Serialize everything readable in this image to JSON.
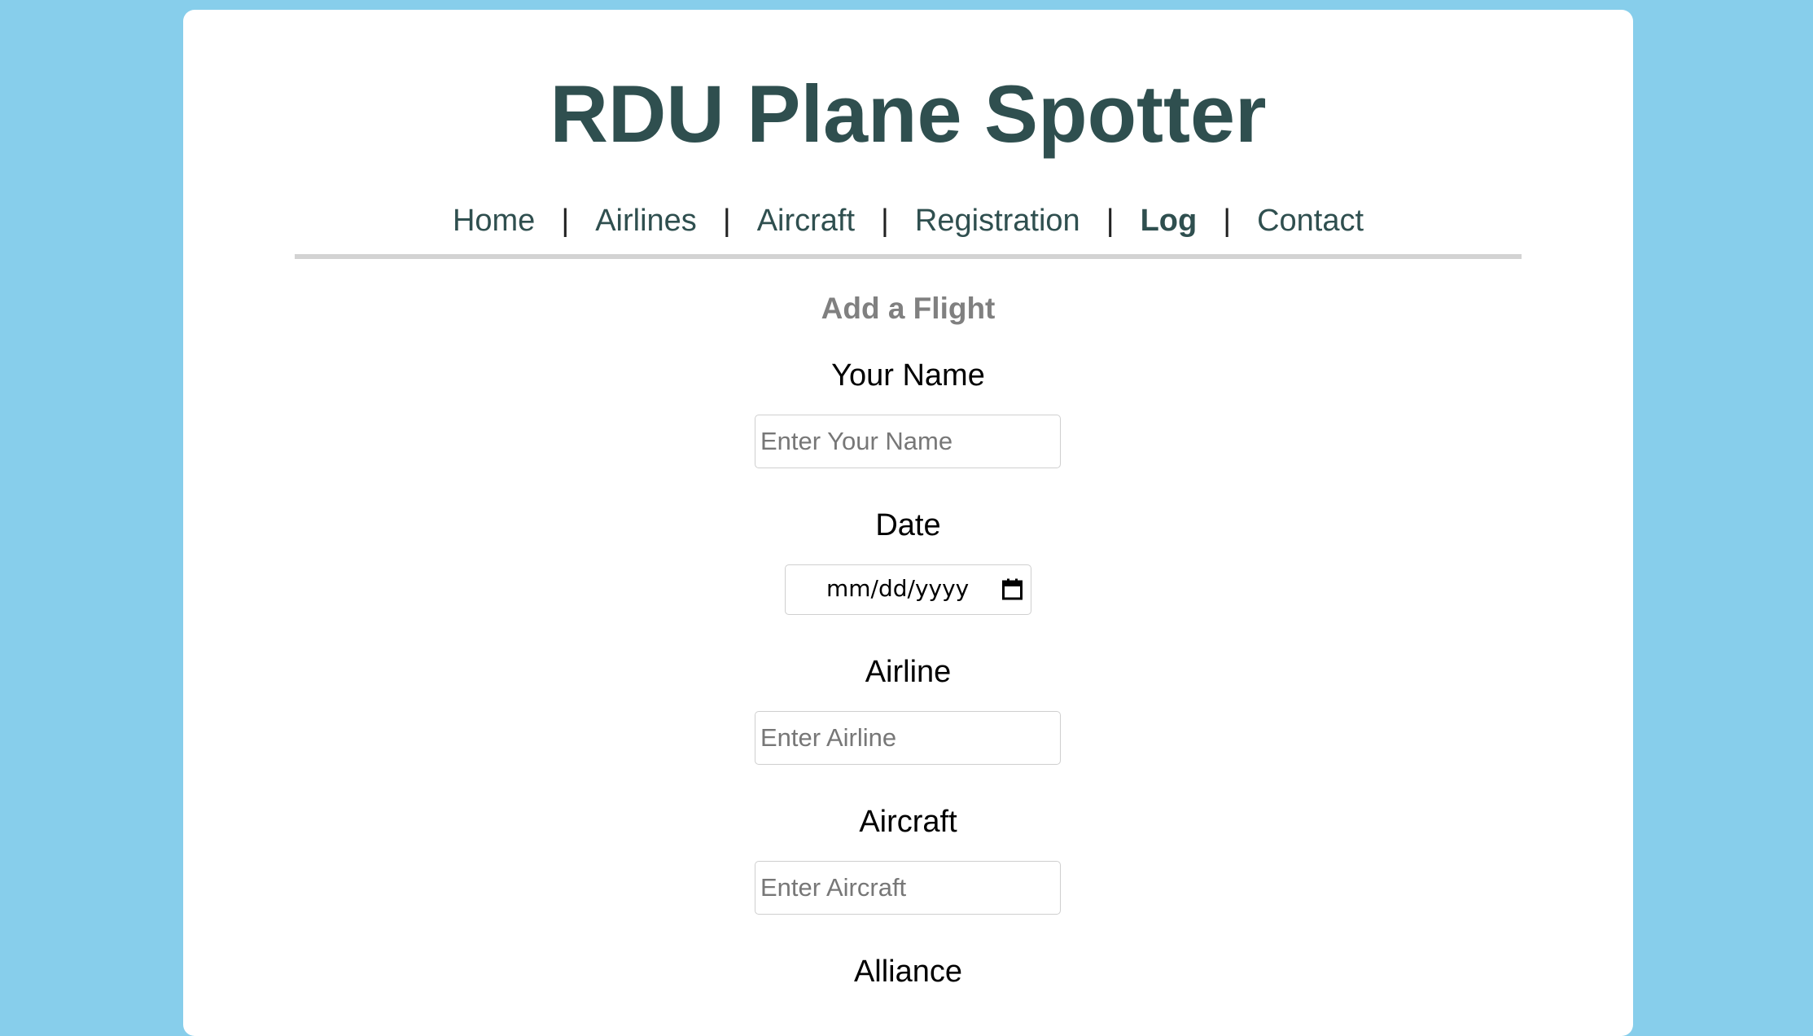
{
  "site": {
    "title": "RDU Plane Spotter"
  },
  "nav": {
    "items": [
      {
        "label": "Home"
      },
      {
        "label": "Airlines"
      },
      {
        "label": "Aircraft"
      },
      {
        "label": "Registration"
      },
      {
        "label": "Log",
        "active": true
      },
      {
        "label": "Contact"
      }
    ],
    "separator": "|"
  },
  "form": {
    "heading": "Add a Flight",
    "name": {
      "label": "Your Name",
      "placeholder": "Enter Your Name",
      "value": ""
    },
    "date": {
      "label": "Date",
      "placeholder": "mm/dd/yyyy",
      "icon": "calendar-icon"
    },
    "airline": {
      "label": "Airline",
      "placeholder": "Enter Airline",
      "value": ""
    },
    "aircraft": {
      "label": "Aircraft",
      "placeholder": "Enter Aircraft",
      "value": ""
    },
    "alliance": {
      "label": "Alliance"
    }
  },
  "colors": {
    "background": "#87ceeb",
    "card": "#ffffff",
    "title": "#2f4f4f",
    "heading": "#808080",
    "rule": "#d3d3d3"
  }
}
